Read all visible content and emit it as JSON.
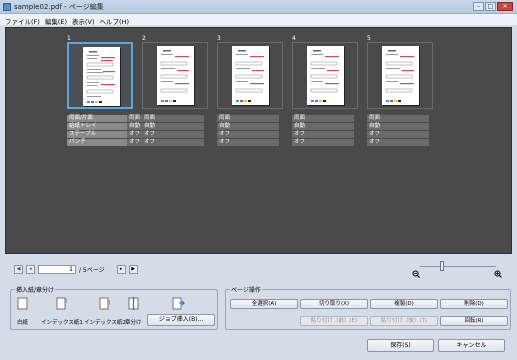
{
  "window": {
    "title": "sample02.pdf - ページ編集",
    "min": "–",
    "max": "□",
    "close": "✕"
  },
  "menu": [
    "ファイル(F)",
    "編集(E)",
    "表示(V)",
    "ヘルプ(H)"
  ],
  "pages": [
    {
      "num": "1",
      "selected": true
    },
    {
      "num": "2",
      "selected": false
    },
    {
      "num": "3",
      "selected": false
    },
    {
      "num": "4",
      "selected": false
    },
    {
      "num": "5",
      "selected": false
    }
  ],
  "properties": {
    "labels": [
      "両面/片面",
      "給紙トレイ",
      "ステープル",
      "パンチ"
    ],
    "values": [
      "両面",
      "自動",
      "オフ",
      "オフ"
    ]
  },
  "pager": {
    "current": "1",
    "total": "/ 5ページ"
  },
  "insert_group": {
    "title": "挿入紙/章分け",
    "items": [
      "白紙",
      "インデックス紙1",
      "インデックス紙2",
      "章分け"
    ],
    "job_button": "ジョブ挿入(B)..."
  },
  "page_ops": {
    "title": "ページ操作",
    "select_all": "全選択(A)",
    "cut": "切り取り(X)",
    "copy": "複製(D)",
    "delete": "削除(D)",
    "paste_before": "貼り付け（前）(E)",
    "paste_after": "貼り付け（後）(T)",
    "rotate": "回転(R)"
  },
  "footer": {
    "save": "保存(S)",
    "cancel": "キャンセル"
  },
  "colors": {
    "canvas": "#4a4a4a",
    "selection": "#5aa6e0",
    "accent_red": "#d44a5a"
  }
}
